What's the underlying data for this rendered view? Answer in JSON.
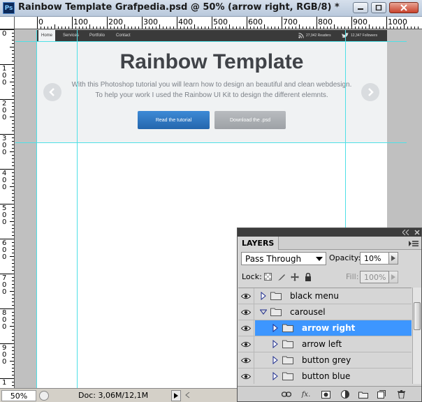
{
  "window": {
    "app_icon_text": "Ps",
    "title": "Rainbow Template Grafpedia.psd @ 50% (arrow right, RGB/8) *"
  },
  "rulers": {
    "top_labels": [
      "0",
      "100",
      "200",
      "300",
      "400",
      "500",
      "600",
      "700",
      "800",
      "900",
      "1000"
    ],
    "left_labels": [
      "0",
      "1\n0\n0",
      "2\n0\n0",
      "3\n0\n0",
      "4\n0\n0",
      "5\n0\n0",
      "6\n0\n0",
      "7\n0\n0",
      "8\n0\n0",
      "9\n0\n0",
      "1"
    ]
  },
  "document": {
    "nav": [
      "Home",
      "Services",
      "Portfolio",
      "Contact"
    ],
    "readers": "27,942 Readers",
    "followers": "12,347 Followers",
    "hero_title": "Rainbow Template",
    "hero_description": "With this Photoshop tutorial you will learn how to design an beautiful and clean webdesign. To help your work I used the Rainbow UI Kit to design the different elemnts.",
    "btn_primary": "Read the tutorial",
    "btn_secondary": "Download the .psd"
  },
  "status": {
    "zoom": "50%",
    "doc_info": "Doc: 3,06M/12,1M"
  },
  "layers_panel": {
    "tab_label": "LAYERS",
    "blend_mode": "Pass Through",
    "opacity_label": "Opacity:",
    "opacity_value": "10%",
    "lock_label": "Lock:",
    "fill_label": "Fill:",
    "fill_value": "100%",
    "layers": [
      {
        "name": "black menu",
        "expanded": false,
        "indent": 0,
        "selected": false
      },
      {
        "name": "carousel",
        "expanded": true,
        "indent": 0,
        "selected": false
      },
      {
        "name": "arrow right",
        "expanded": false,
        "indent": 1,
        "selected": true
      },
      {
        "name": "arrow left",
        "expanded": false,
        "indent": 1,
        "selected": false
      },
      {
        "name": "button grey",
        "expanded": false,
        "indent": 1,
        "selected": false
      },
      {
        "name": "button blue",
        "expanded": false,
        "indent": 1,
        "selected": false
      }
    ]
  },
  "colors": {
    "accent_blue": "#2a72c0",
    "selection_blue": "#3d96ff",
    "guide_cyan": "#4ee0e6"
  }
}
